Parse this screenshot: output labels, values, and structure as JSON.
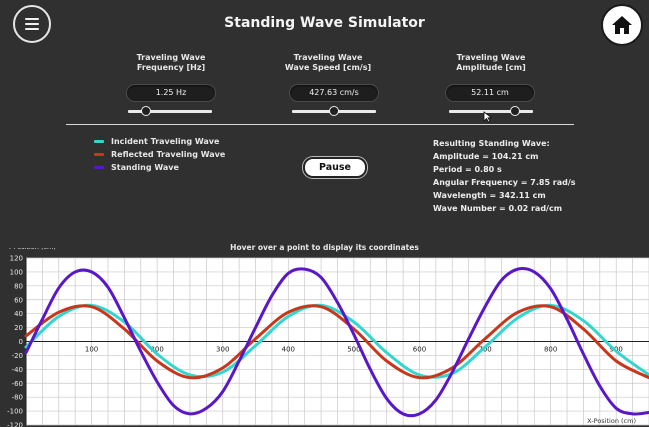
{
  "app": {
    "title": "Standing Wave Simulator"
  },
  "header": {
    "menu_icon": "hamburger-menu-icon",
    "home_icon": "home-icon"
  },
  "controls": [
    {
      "label_line1": "Traveling Wave",
      "label_line2": "Frequency [Hz]",
      "value": "1.25 Hz",
      "slider_fraction": 0.22
    },
    {
      "label_line1": "Traveling Wave",
      "label_line2": "Wave Speed [cm/s]",
      "value": "427.63 cm/s",
      "slider_fraction": 0.5
    },
    {
      "label_line1": "Traveling Wave",
      "label_line2": "Amplitude [cm]",
      "value": "52.11 cm",
      "slider_fraction": 0.79
    }
  ],
  "legend": [
    {
      "label": "Incident Traveling Wave",
      "color": "#33d6cf"
    },
    {
      "label": "Reflected Traveling Wave",
      "color": "#c8361c"
    },
    {
      "label": "Standing Wave",
      "color": "#5a17c7"
    }
  ],
  "pause_button": {
    "label": "Pause"
  },
  "results": {
    "heading": "Resulting Standing Wave:",
    "lines": [
      "Amplitude = 104.21 cm",
      "Period = 0.80 s",
      "Angular Frequency = 7.85 rad/s",
      "Wavelength = 342.11 cm",
      "Wave Number = 0.02 rad/cm"
    ]
  },
  "plot": {
    "hint": "Hover over a point to display its coordinates",
    "colors": {
      "background": "#ffffff",
      "grid": "#c8c8c8",
      "axis": "#202020"
    }
  },
  "chart_data": {
    "type": "line",
    "title": "",
    "xlabel": "X-Position (cm)",
    "ylabel": "Y-Position (cm)",
    "xlim": [
      0,
      950
    ],
    "ylim": [
      -120,
      120
    ],
    "x_ticks": [
      100,
      200,
      300,
      400,
      500,
      600,
      700,
      800,
      900
    ],
    "y_ticks": [
      120,
      100,
      80,
      60,
      40,
      20,
      0,
      -20,
      -40,
      -60,
      -80,
      -100,
      -120
    ],
    "grid": true,
    "series": [
      {
        "name": "Incident Traveling Wave",
        "color": "#33d6cf",
        "x": [
          0,
          50,
          100,
          150,
          200,
          250,
          300,
          350,
          400,
          450,
          500,
          550,
          600,
          650,
          700,
          750,
          800,
          850,
          900,
          950
        ],
        "y": [
          -8,
          36,
          52,
          28,
          -18,
          -48,
          -44,
          -6,
          36,
          52,
          28,
          -16,
          -48,
          -46,
          -8,
          34,
          52,
          30,
          -14,
          -48
        ]
      },
      {
        "name": "Reflected Traveling Wave",
        "color": "#c8361c",
        "x": [
          0,
          50,
          100,
          150,
          200,
          250,
          300,
          350,
          400,
          450,
          500,
          550,
          600,
          650,
          700,
          750,
          800,
          850,
          900,
          950
        ],
        "y": [
          8,
          42,
          50,
          18,
          -28,
          -52,
          -38,
          4,
          42,
          50,
          18,
          -28,
          -52,
          -38,
          4,
          42,
          50,
          18,
          -28,
          -52
        ]
      },
      {
        "name": "Standing Wave",
        "color": "#5a17c7",
        "x": [
          0,
          25,
          50,
          75,
          100,
          125,
          150,
          175,
          200,
          225,
          250,
          275,
          300,
          325,
          350,
          375,
          400,
          425,
          450,
          475,
          500,
          525,
          550,
          575,
          600,
          625,
          650,
          675,
          700,
          725,
          750,
          775,
          800,
          825,
          850,
          875,
          900,
          925,
          950
        ],
        "y": [
          -16,
          32,
          77,
          100,
          100,
          78,
          34,
          -14,
          -58,
          -92,
          -104,
          -96,
          -72,
          -28,
          20,
          66,
          98,
          104,
          92,
          56,
          10,
          -40,
          -82,
          -104,
          -104,
          -84,
          -44,
          4,
          50,
          88,
          104,
          100,
          76,
          32,
          -18,
          -64,
          -96,
          -104,
          -102
        ]
      }
    ]
  }
}
